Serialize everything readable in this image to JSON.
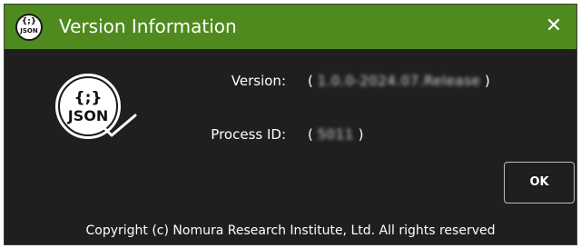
{
  "window": {
    "title": "Version Information",
    "close_icon": "close-icon",
    "title_icon": "json-logo-icon",
    "title_icon_braces": "{;}",
    "title_icon_text": "JSON"
  },
  "logo": {
    "icon": "json-logo-icon",
    "braces": "{;}",
    "text": "JSON"
  },
  "info": {
    "version_label": "Version:",
    "version_value": "1.0.0-2024.07.Release",
    "process_id_label": "Process ID:",
    "process_id_value": "5011"
  },
  "buttons": {
    "ok_label": "OK"
  },
  "footer": {
    "copyright": "Copyright (c) Nomura Research Institute, Ltd. All rights reserved"
  },
  "colors": {
    "titlebar": "#4f8a1e",
    "background": "#1f1f1f",
    "text": "#ffffff",
    "button_border": "#bdbdbd"
  }
}
